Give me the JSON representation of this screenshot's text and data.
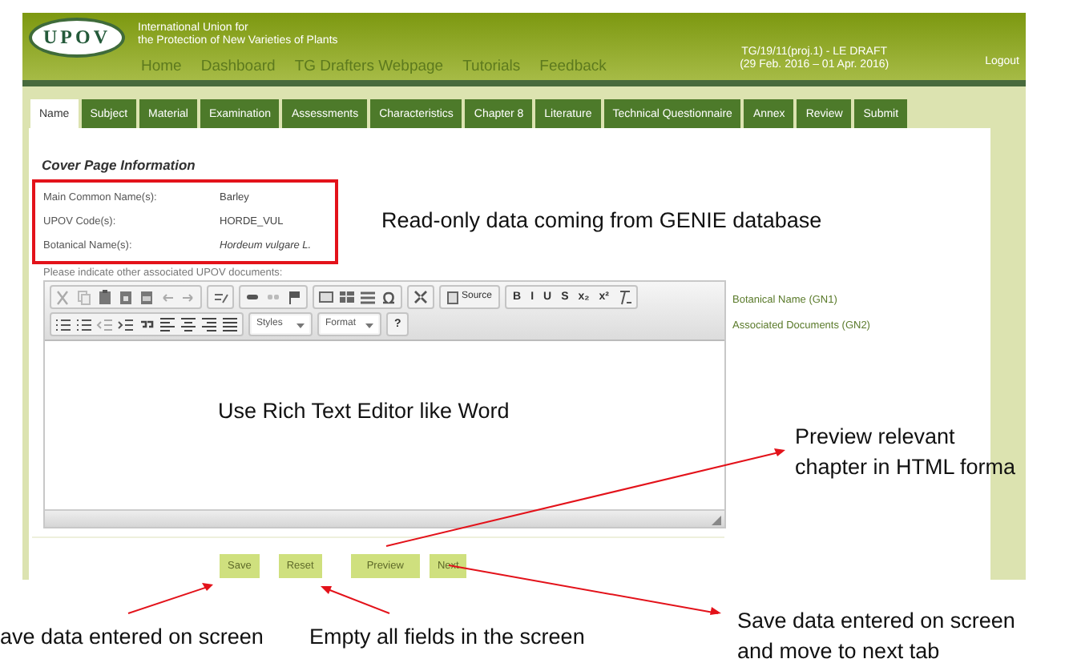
{
  "header": {
    "logo": "UPOV",
    "title_lines": [
      "International Union for",
      "the Protection of New Varieties of Plants"
    ],
    "nav": [
      "Home",
      "Dashboard",
      "TG Drafters Webpage",
      "Tutorials",
      "Feedback"
    ],
    "draft_lines": [
      "TG/19/11(proj.1) - LE DRAFT",
      "(29 Feb. 2016 – 01 Apr. 2016)"
    ],
    "logout": "Logout"
  },
  "tabs": [
    {
      "label": "Name",
      "selected": true
    },
    {
      "label": "Subject",
      "selected": false
    },
    {
      "label": "Material",
      "selected": false
    },
    {
      "label": "Examination",
      "selected": false
    },
    {
      "label": "Assessments",
      "selected": false
    },
    {
      "label": "Characteristics",
      "selected": false
    },
    {
      "label": "Chapter 8",
      "selected": false
    },
    {
      "label": "Literature",
      "selected": false
    },
    {
      "label": "Technical Questionnaire",
      "selected": false
    },
    {
      "label": "Annex",
      "selected": false
    },
    {
      "label": "Review",
      "selected": false
    },
    {
      "label": "Submit",
      "selected": false
    }
  ],
  "section_title": "Cover Page Information",
  "readonly_fields": [
    {
      "label": "Main Common Name(s):",
      "value": "Barley",
      "italic": false
    },
    {
      "label": "UPOV Code(s):",
      "value": "HORDE_VUL",
      "italic": false
    },
    {
      "label": "Botanical Name(s):",
      "value": "Hordeum vulgare L.",
      "italic": true
    }
  ],
  "prompt": "Please indicate other associated UPOV documents:",
  "toolbar_rows": [
    [
      [
        {
          "kind": "icon"
        },
        {
          "kind": "icon"
        },
        {
          "kind": "icon"
        },
        {
          "kind": "icon"
        },
        {
          "kind": "icon"
        },
        {
          "kind": "icon"
        },
        {
          "kind": "icon"
        }
      ],
      [
        {
          "kind": "icon"
        }
      ],
      [
        {
          "kind": "icon"
        },
        {
          "kind": "icon"
        },
        {
          "kind": "icon"
        }
      ],
      [
        {
          "kind": "icon"
        },
        {
          "kind": "icon"
        },
        {
          "kind": "icon"
        },
        {
          "kind": "icon"
        }
      ],
      [
        {
          "kind": "icon"
        }
      ],
      [
        {
          "kind": "source",
          "label": "Source"
        }
      ],
      [
        {
          "kind": "text",
          "label": "B"
        },
        {
          "kind": "text",
          "label": "I"
        },
        {
          "kind": "text",
          "label": "U"
        },
        {
          "kind": "text",
          "label": "S"
        },
        {
          "kind": "text",
          "label": "x₂"
        },
        {
          "kind": "text",
          "label": "x²"
        },
        {
          "kind": "icon"
        }
      ]
    ],
    [
      [
        {
          "kind": "icon"
        },
        {
          "kind": "icon"
        },
        {
          "kind": "icon"
        },
        {
          "kind": "icon"
        },
        {
          "kind": "icon"
        },
        {
          "kind": "icon"
        },
        {
          "kind": "icon"
        },
        {
          "kind": "icon"
        },
        {
          "kind": "icon"
        }
      ],
      [
        {
          "kind": "dropdown",
          "label": "Styles"
        }
      ],
      [
        {
          "kind": "dropdown",
          "label": "Format"
        }
      ],
      [
        {
          "kind": "text",
          "label": "?"
        }
      ]
    ]
  ],
  "side_links": [
    "Botanical Name (GN1)",
    "Associated Documents (GN2)"
  ],
  "buttons": [
    "Save",
    "Reset",
    "Preview",
    "Next"
  ],
  "annotations": [
    {
      "text": "Read-only data coming from GENIE database"
    },
    {
      "text": "Use Rich Text Editor like Word"
    },
    {
      "text": "Preview relevant"
    },
    {
      "text": "chapter in HTML forma"
    },
    {
      "text": "ave data entered on screen"
    },
    {
      "text": "Empty all fields in the screen"
    },
    {
      "text": "Save data entered on screen"
    },
    {
      "text": "and move to next tab"
    }
  ]
}
